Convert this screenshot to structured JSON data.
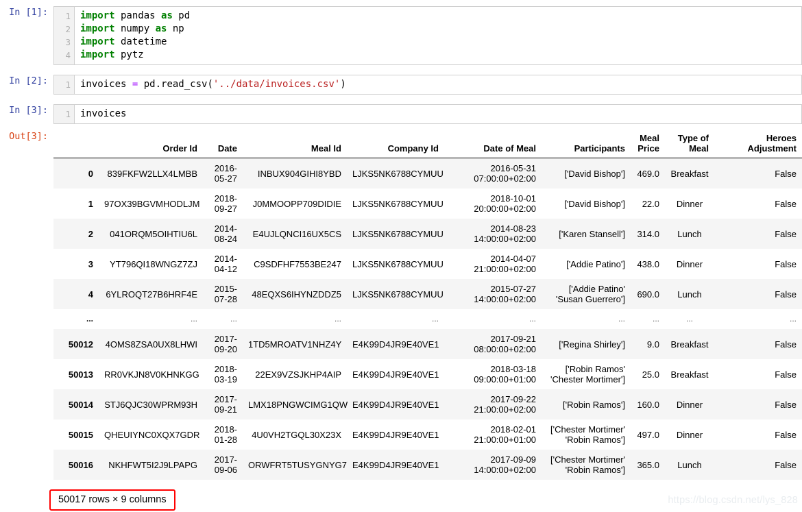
{
  "notebook": {
    "cells": [
      {
        "prompt": "In [1]:",
        "lines": [
          "1",
          "2",
          "3",
          "4"
        ],
        "code_html": "<span class=\"kw\">import</span> pandas <span class=\"kw\">as</span> pd\n<span class=\"kw\">import</span> numpy <span class=\"kw\">as</span> np\n<span class=\"kw\">import</span> datetime\n<span class=\"kw\">import</span> pytz",
        "code_plain": "import pandas as pd\nimport numpy as np\nimport datetime\nimport pytz"
      },
      {
        "prompt": "In [2]:",
        "lines": [
          "1"
        ],
        "code_html": "invoices <span class=\"op\">=</span> pd.read_csv(<span class=\"str\">'../data/invoices.csv'</span>)",
        "code_plain": "invoices = pd.read_csv('../data/invoices.csv')"
      },
      {
        "prompt": "In [3]:",
        "lines": [
          "1"
        ],
        "code_html": "invoices",
        "code_plain": "invoices"
      }
    ],
    "output_prompt": "Out[3]:"
  },
  "dataframe": {
    "columns": [
      "",
      "Order Id",
      "Date",
      "Meal Id",
      "Company Id",
      "Date of Meal",
      "Participants",
      "Meal Price",
      "Type of Meal",
      "Heroes Adjustment"
    ],
    "rows": [
      {
        "index": "0",
        "order_id": "839FKFW2LLX4LMBB",
        "date": "2016-\n05-27",
        "meal_id": "INBUX904GIHI8YBD",
        "company_id": "LJKS5NK6788CYMUU",
        "date_of_meal": "2016-05-31\n07:00:00+02:00",
        "participants": "['David Bishop']",
        "meal_price": "469.0",
        "type_of_meal": "Breakfast",
        "heroes_adjustment": "False"
      },
      {
        "index": "1",
        "order_id": "97OX39BGVMHODLJM",
        "date": "2018-\n09-27",
        "meal_id": "J0MMOOPP709DIDIE",
        "company_id": "LJKS5NK6788CYMUU",
        "date_of_meal": "2018-10-01\n20:00:00+02:00",
        "participants": "['David Bishop']",
        "meal_price": "22.0",
        "type_of_meal": "Dinner",
        "heroes_adjustment": "False"
      },
      {
        "index": "2",
        "order_id": "041ORQM5OIHTIU6L",
        "date": "2014-\n08-24",
        "meal_id": "E4UJLQNCI16UX5CS",
        "company_id": "LJKS5NK6788CYMUU",
        "date_of_meal": "2014-08-23\n14:00:00+02:00",
        "participants": "['Karen Stansell']",
        "meal_price": "314.0",
        "type_of_meal": "Lunch",
        "heroes_adjustment": "False"
      },
      {
        "index": "3",
        "order_id": "YT796QI18WNGZ7ZJ",
        "date": "2014-\n04-12",
        "meal_id": "C9SDFHF7553BE247",
        "company_id": "LJKS5NK6788CYMUU",
        "date_of_meal": "2014-04-07\n21:00:00+02:00",
        "participants": "['Addie Patino']",
        "meal_price": "438.0",
        "type_of_meal": "Dinner",
        "heroes_adjustment": "False"
      },
      {
        "index": "4",
        "order_id": "6YLROQT27B6HRF4E",
        "date": "2015-\n07-28",
        "meal_id": "48EQXS6IHYNZDDZ5",
        "company_id": "LJKS5NK6788CYMUU",
        "date_of_meal": "2015-07-27\n14:00:00+02:00",
        "participants": "['Addie Patino'\n'Susan Guerrero']",
        "meal_price": "690.0",
        "type_of_meal": "Lunch",
        "heroes_adjustment": "False"
      },
      {
        "index": "...",
        "order_id": "...",
        "date": "...",
        "meal_id": "...",
        "company_id": "...",
        "date_of_meal": "...",
        "participants": "...",
        "meal_price": "...",
        "type_of_meal": "...",
        "heroes_adjustment": "...",
        "ellipsis": true
      },
      {
        "index": "50012",
        "order_id": "4OMS8ZSA0UX8LHWI",
        "date": "2017-\n09-20",
        "meal_id": "1TD5MROATV1NHZ4Y",
        "company_id": "E4K99D4JR9E40VE1",
        "date_of_meal": "2017-09-21\n08:00:00+02:00",
        "participants": "['Regina Shirley']",
        "meal_price": "9.0",
        "type_of_meal": "Breakfast",
        "heroes_adjustment": "False"
      },
      {
        "index": "50013",
        "order_id": "RR0VKJN8V0KHNKGG",
        "date": "2018-\n03-19",
        "meal_id": "22EX9VZSJKHP4AIP",
        "company_id": "E4K99D4JR9E40VE1",
        "date_of_meal": "2018-03-18\n09:00:00+01:00",
        "participants": "['Robin Ramos'\n'Chester Mortimer']",
        "meal_price": "25.0",
        "type_of_meal": "Breakfast",
        "heroes_adjustment": "False"
      },
      {
        "index": "50014",
        "order_id": "STJ6QJC30WPRM93H",
        "date": "2017-\n09-21",
        "meal_id": "LMX18PNGWCIMG1QW",
        "company_id": "E4K99D4JR9E40VE1",
        "date_of_meal": "2017-09-22\n21:00:00+02:00",
        "participants": "['Robin Ramos']",
        "meal_price": "160.0",
        "type_of_meal": "Dinner",
        "heroes_adjustment": "False"
      },
      {
        "index": "50015",
        "order_id": "QHEUIYNC0XQX7GDR",
        "date": "2018-\n01-28",
        "meal_id": "4U0VH2TGQL30X23X",
        "company_id": "E4K99D4JR9E40VE1",
        "date_of_meal": "2018-02-01\n21:00:00+01:00",
        "participants": "['Chester Mortimer'\n'Robin Ramos']",
        "meal_price": "497.0",
        "type_of_meal": "Dinner",
        "heroes_adjustment": "False"
      },
      {
        "index": "50016",
        "order_id": "NKHFWT5I2J9LPAPG",
        "date": "2017-\n09-06",
        "meal_id": "ORWFRT5TUSYGNYG7",
        "company_id": "E4K99D4JR9E40VE1",
        "date_of_meal": "2017-09-09\n14:00:00+02:00",
        "participants": "['Chester Mortimer'\n'Robin Ramos']",
        "meal_price": "365.0",
        "type_of_meal": "Lunch",
        "heroes_adjustment": "False"
      }
    ],
    "shape_label": "50017 rows × 9 columns"
  },
  "watermark": {
    "text": "https://blog.csdn.net/lys_828"
  },
  "colors": {
    "in_prompt": "#303F9F",
    "out_prompt": "#D84315",
    "keyword": "#008000",
    "string": "#BA2121",
    "operator": "#AA22FF",
    "highlight_box_border": "#ff0000",
    "row_stripe": "#f5f5f5"
  }
}
